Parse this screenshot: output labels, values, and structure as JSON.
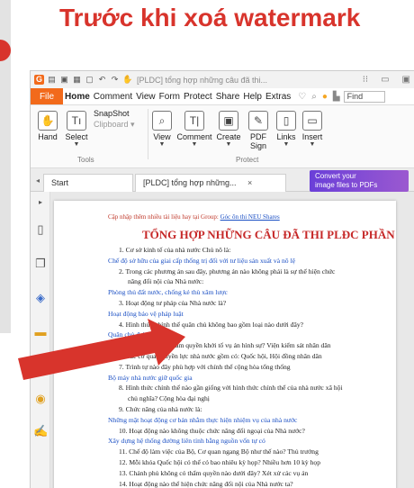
{
  "headline": "Trước khi xoá watermark",
  "window": {
    "title": "[PLDC] tổng hợp những câu đã thi...",
    "title_icons": [
      "app-icon",
      "open-icon",
      "save-icon",
      "print-icon",
      "new-icon",
      "undo-icon",
      "redo-icon",
      "hand-icon"
    ]
  },
  "menu": {
    "file": "File",
    "items": [
      "Home",
      "Comment",
      "View",
      "Form",
      "Protect",
      "Share",
      "Help",
      "Extras"
    ],
    "active": "Home",
    "find_placeholder": "Find"
  },
  "ribbon": {
    "hand": "Hand",
    "select": "Select",
    "snapshot": "SnapShot",
    "clipboard": "Clipboard",
    "tools_group": "Tools",
    "view": "View",
    "comment": "Comment",
    "create": "Create",
    "pdf_sign": "PDF Sign",
    "links": "Links",
    "insert": "Insert",
    "protect_group": "Protect"
  },
  "tabs": {
    "start": "Start",
    "doc": "[PLDC] tổng hợp những...",
    "close": "×",
    "promo_line1": "Convert your",
    "promo_line2": "image files to PDFs"
  },
  "document": {
    "top_note_prefix": "Cập nhập thêm nhiều tài liệu hay tại Group: ",
    "top_note_link": "Góc ôn thi NEU Shares",
    "title": "TỔNG HỢP NHỮNG CÂU ĐÃ THI PLĐC PHẦN 2",
    "lines": [
      {
        "text": "1.   Cơ sở kinh tế của nhà nước Chủ nô là:",
        "color": "black",
        "indent": 1
      },
      {
        "text": "Chế độ sở hữu của giai cấp thống trị đối với tư liệu sản xuất và nô lệ",
        "color": "blue",
        "indent": 0
      },
      {
        "text": "2.   Trong các phương án sau đây, phương án nào không phải là sự thể hiện chức",
        "color": "black",
        "indent": 1
      },
      {
        "text": "năng đối nội của Nhà nước:",
        "color": "black",
        "indent": 2
      },
      {
        "text": "Phòng thủ đất nước, chống kẻ thù xâm lược",
        "color": "blue",
        "indent": 0
      },
      {
        "text": "3.   Hoạt động tư pháp của Nhà nước là?",
        "color": "black",
        "indent": 1
      },
      {
        "text": "Hoạt động bảo vệ pháp luật",
        "color": "blue",
        "indent": 0
      },
      {
        "text": "4.   Hình thức chính thể quân chủ không bao gồm loại nào dưới đây?",
        "color": "black",
        "indent": 1
      },
      {
        "text": "Quân chủ đại nghị",
        "color": "blue",
        "indent": 0
      },
      {
        "text": "5.   Cơ quan nào có thẩm quyền khởi tố vụ án hình sự? Viện kiểm sát nhân dân",
        "color": "black",
        "indent": 1
      },
      {
        "text": "6.   Các cơ quan quyền lực nhà nước gồm có: Quốc hội, Hội đồng nhân dân",
        "color": "black",
        "indent": 1
      },
      {
        "text": "7.   Trình tự nào đây phù hợp với chính thể cộng hòa tổng thống",
        "color": "black",
        "indent": 1
      },
      {
        "text": "Bộ máy nhà nước giữ quốc gia",
        "color": "blue",
        "indent": 0
      },
      {
        "text": "8.   Hình thức chính thể nào gần giống với hình thức chính thể của nhà nước xã hội",
        "color": "black",
        "indent": 1
      },
      {
        "text": "chủ nghĩa? Cộng hòa đại nghị",
        "color": "black",
        "indent": 2
      },
      {
        "text": "9.   Chức năng của nhà nước là:",
        "color": "black",
        "indent": 1
      },
      {
        "text": "Những mặt hoạt động cơ bản nhằm thực hiện nhiệm vụ của nhà nước",
        "color": "blue",
        "indent": 0
      },
      {
        "text": "10. Hoạt động nào không thuộc chức năng đối ngoại của Nhà nước?",
        "color": "black",
        "indent": 1
      },
      {
        "text": "Xây dựng hệ thống đường liên tỉnh bằng nguồn vốn tự có",
        "color": "blue",
        "indent": 0
      },
      {
        "text": "11. Chế độ làm việc của Bộ, Cơ quan ngang Bộ như thế nào? Thủ trưởng",
        "color": "black",
        "indent": 1
      },
      {
        "text": "12. Mỗi khóa Quốc hội có thể có bao nhiêu kỳ họp? Nhiều hơn 10 kỳ họp",
        "color": "black",
        "indent": 1
      },
      {
        "text": "13. Chánh phủ không có thẩm quyền nào dưới đây? Xét xử các vụ án",
        "color": "black",
        "indent": 1
      },
      {
        "text": "14. Hoạt động nào thể hiện chức năng đối nội của Nhà nước ta?",
        "color": "black",
        "indent": 1
      }
    ]
  },
  "colors": {
    "accent_red": "#d8342c",
    "foxit_orange": "#f26a1b",
    "link_blue": "#1a4fc4",
    "promo_purple": "#6a3fd8"
  },
  "side_icons": [
    "thumbnail-icon",
    "pages-icon",
    "layers-icon",
    "comments-icon",
    "attachments-icon",
    "security-icon",
    "sign-icon"
  ]
}
